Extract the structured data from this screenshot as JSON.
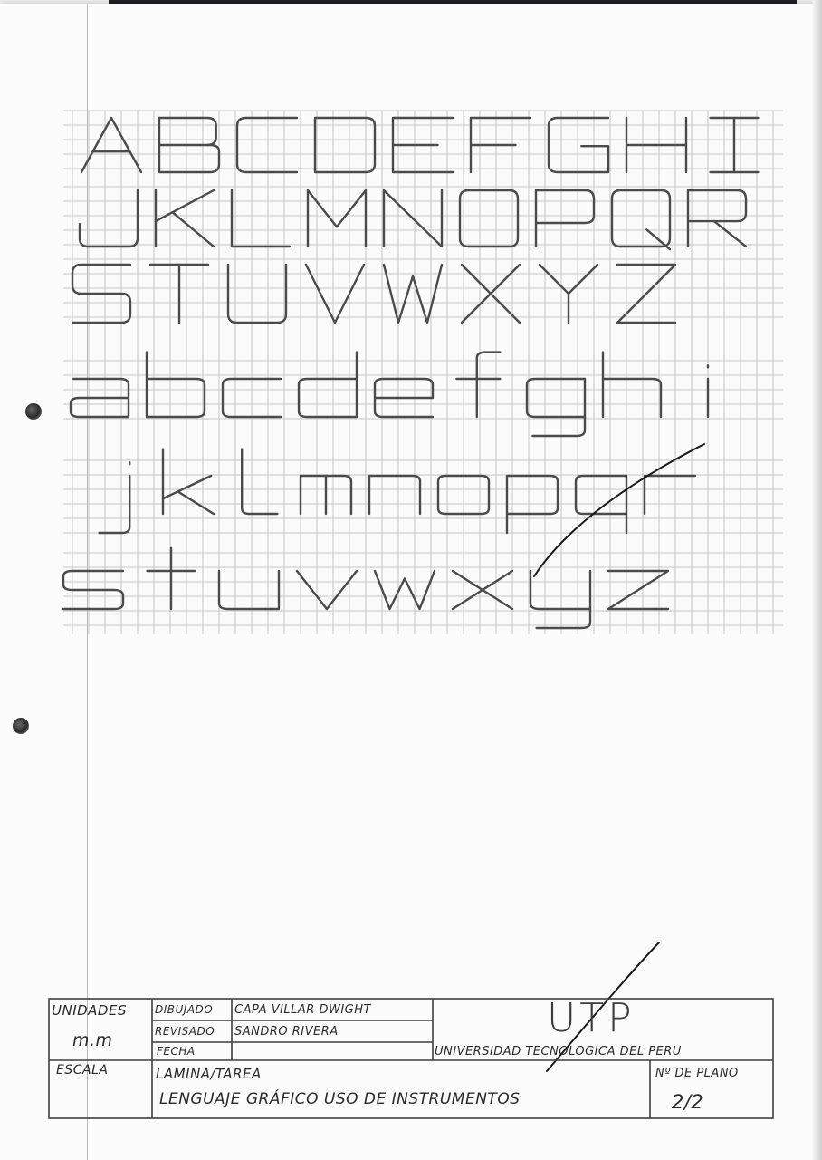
{
  "lettering": {
    "rows": [
      [
        "A",
        "B",
        "C",
        "D",
        "E",
        "F",
        "G",
        "H",
        "I"
      ],
      [
        "J",
        "K",
        "L",
        "M",
        "N",
        "O",
        "P",
        "Q",
        "R"
      ],
      [
        "S",
        "T",
        "U",
        "V",
        "W",
        "X",
        "Y",
        "Z"
      ],
      [
        "a",
        "b",
        "c",
        "d",
        "e",
        "f",
        "g",
        "h",
        "i"
      ],
      [
        "j",
        "k",
        "l",
        "m",
        "n",
        "o",
        "p",
        "q",
        "r"
      ],
      [
        "s",
        "t",
        "u",
        "v",
        "w",
        "x",
        "y",
        "z"
      ]
    ]
  },
  "title_block": {
    "unidades_label": "UNIDADES",
    "unidades_value": "m.m",
    "escala_label": "ESCALA",
    "dibujado_label": "DIBUJADO",
    "dibujado_value": "CAPA VILLAR DWIGHT",
    "revisado_label": "REVISADO",
    "revisado_value": "SANDRO RIVERA",
    "fecha_label": "FECHA",
    "lamina_label": "LAMINA/TAREA",
    "lamina_value": "LENGUAJE GRÁFICO USO DE INSTRUMENTOS",
    "logo": "UTP",
    "university": "UNIVERSIDAD TECNOLOGICA DEL PERU",
    "plano_label": "Nº DE PLANO",
    "plano_value": "2/2"
  },
  "colors": {
    "pencil": "#4b4b4b",
    "grid": "#c6c6c6",
    "paper": "#fbfbfb"
  }
}
